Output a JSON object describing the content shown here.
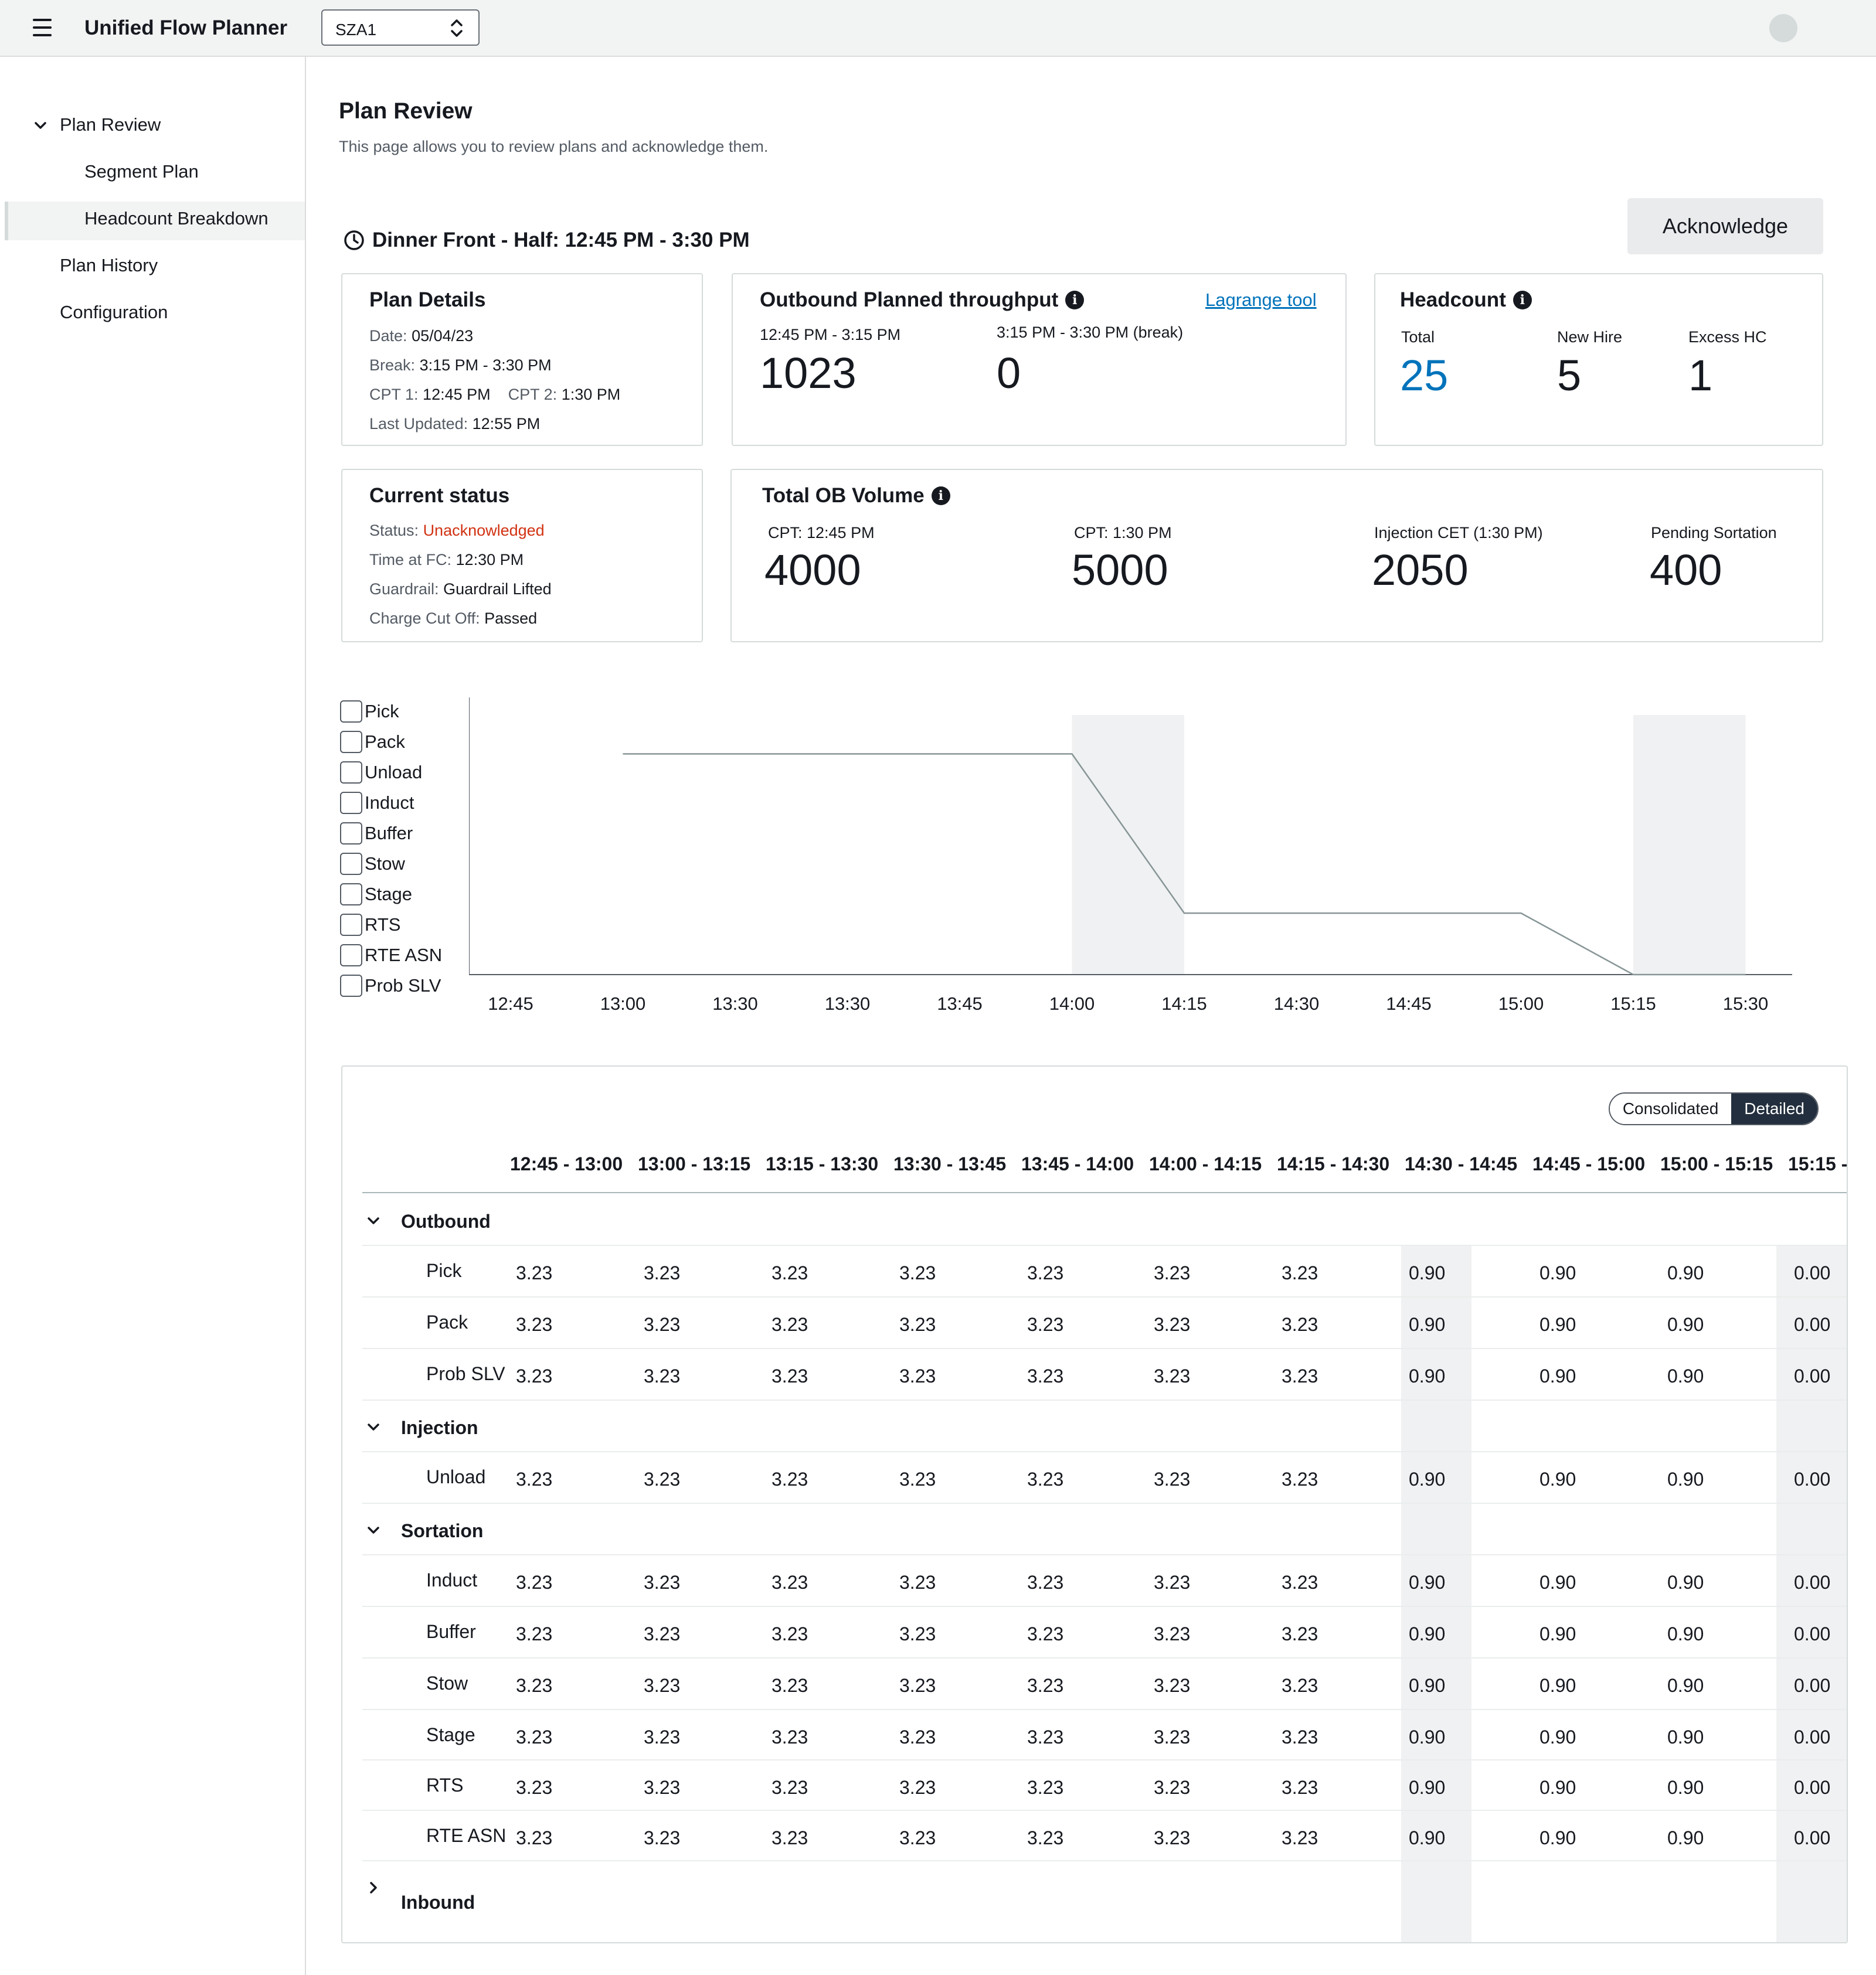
{
  "app": {
    "title": "Unified Flow Planner",
    "site": "SZA1"
  },
  "sidebar": {
    "items": [
      {
        "label": "Plan Review"
      },
      {
        "label": "Segment Plan"
      },
      {
        "label": "Headcount Breakdown"
      },
      {
        "label": "Plan History"
      },
      {
        "label": "Configuration"
      }
    ]
  },
  "page": {
    "title": "Plan Review",
    "description": "This page allows you to review plans and acknowledge them.",
    "shift_title": "Dinner Front - Half: 12:45 PM - 3:30 PM",
    "acknowledge_label": "Acknowledge"
  },
  "plan_details": {
    "title": "Plan Details",
    "date_label": "Date:",
    "date": "05/04/23",
    "break_label": "Break:",
    "break": "3:15 PM - 3:30 PM",
    "cpt1_label": "CPT 1:",
    "cpt1": "12:45 PM",
    "cpt2_label": "CPT 2:",
    "cpt2": "1:30 PM",
    "updated_label": "Last Updated:",
    "updated": "12:55 PM"
  },
  "throughput": {
    "title": "Outbound Planned throughput",
    "link": "Lagrange tool",
    "p1_label": "12:45 PM - 3:15 PM",
    "p1_value": "1023",
    "p2_label": "3:15 PM - 3:30 PM (break)",
    "p2_value": "0"
  },
  "headcount": {
    "title": "Headcount",
    "total_label": "Total",
    "total": "25",
    "newhire_label": "New Hire",
    "newhire": "5",
    "excess_label": "Excess HC",
    "excess": "1",
    "accent_color": "#0073bb"
  },
  "current_status": {
    "title": "Current status",
    "status_label": "Status:",
    "status": "Unacknowledged",
    "time_label": "Time at FC:",
    "time": "12:30 PM",
    "guardrail_label": "Guardrail:",
    "guardrail": "Guardrail Lifted",
    "charge_label": "Charge Cut Off:",
    "charge": "Passed",
    "status_color": "#d13212"
  },
  "ob_volume": {
    "title": "Total OB Volume",
    "items": [
      {
        "label": "CPT: 12:45 PM",
        "value": "4000"
      },
      {
        "label": "CPT: 1:30 PM",
        "value": "5000"
      },
      {
        "label": "Injection CET (1:30 PM)",
        "value": "2050"
      },
      {
        "label": "Pending Sortation",
        "value": "400"
      }
    ]
  },
  "chart_legend": [
    "Pick",
    "Pack",
    "Unload",
    "Induct",
    "Buffer",
    "Stow",
    "Stage",
    "RTS",
    "RTE ASN",
    "Prob SLV"
  ],
  "chart_data": {
    "type": "line",
    "categories": [
      "12:45",
      "13:00",
      "13:30",
      "13:30",
      "13:45",
      "14:00",
      "14:15",
      "14:30",
      "14:45",
      "15:00",
      "15:15",
      "15:30"
    ],
    "series": [
      {
        "values": [
          null,
          3.23,
          3.23,
          3.23,
          3.23,
          3.23,
          0.9,
          0.9,
          0.9,
          0.9,
          0.0,
          0.0
        ]
      }
    ],
    "shaded_categories": [
      "14:00",
      "15:15"
    ],
    "ylim": [
      0,
      3.8
    ],
    "grid": false
  },
  "table": {
    "toggle": {
      "consolidated": "Consolidated",
      "detailed": "Detailed"
    },
    "columns": [
      "12:45 - 13:00",
      "13:00 - 13:15",
      "13:15 - 13:30",
      "13:30 - 13:45",
      "13:45 - 14:00",
      "14:00 - 14:15",
      "14:15 - 14:30",
      "14:30 - 14:45",
      "14:45 - 15:00",
      "15:00 - 15:15",
      "15:15 -"
    ],
    "groups": [
      {
        "name": "Outbound",
        "rows": [
          {
            "label": "Pick",
            "values": [
              "3.23",
              "3.23",
              "3.23",
              "3.23",
              "3.23",
              "3.23",
              "3.23",
              "0.90",
              "0.90",
              "0.90",
              "0.00"
            ]
          },
          {
            "label": "Pack",
            "values": [
              "3.23",
              "3.23",
              "3.23",
              "3.23",
              "3.23",
              "3.23",
              "3.23",
              "0.90",
              "0.90",
              "0.90",
              "0.00"
            ]
          },
          {
            "label": "Prob SLV",
            "values": [
              "3.23",
              "3.23",
              "3.23",
              "3.23",
              "3.23",
              "3.23",
              "3.23",
              "0.90",
              "0.90",
              "0.90",
              "0.00"
            ]
          }
        ]
      },
      {
        "name": "Injection",
        "rows": [
          {
            "label": "Unload",
            "values": [
              "3.23",
              "3.23",
              "3.23",
              "3.23",
              "3.23",
              "3.23",
              "3.23",
              "0.90",
              "0.90",
              "0.90",
              "0.00"
            ]
          }
        ]
      },
      {
        "name": "Sortation",
        "rows": [
          {
            "label": "Induct",
            "values": [
              "3.23",
              "3.23",
              "3.23",
              "3.23",
              "3.23",
              "3.23",
              "3.23",
              "0.90",
              "0.90",
              "0.90",
              "0.00"
            ]
          },
          {
            "label": "Buffer",
            "values": [
              "3.23",
              "3.23",
              "3.23",
              "3.23",
              "3.23",
              "3.23",
              "3.23",
              "0.90",
              "0.90",
              "0.90",
              "0.00"
            ]
          },
          {
            "label": "Stow",
            "values": [
              "3.23",
              "3.23",
              "3.23",
              "3.23",
              "3.23",
              "3.23",
              "3.23",
              "0.90",
              "0.90",
              "0.90",
              "0.00"
            ]
          },
          {
            "label": "Stage",
            "values": [
              "3.23",
              "3.23",
              "3.23",
              "3.23",
              "3.23",
              "3.23",
              "3.23",
              "0.90",
              "0.90",
              "0.90",
              "0.00"
            ]
          },
          {
            "label": "RTS",
            "values": [
              "3.23",
              "3.23",
              "3.23",
              "3.23",
              "3.23",
              "3.23",
              "3.23",
              "0.90",
              "0.90",
              "0.90",
              "0.00"
            ]
          },
          {
            "label": "RTE ASN",
            "values": [
              "3.23",
              "3.23",
              "3.23",
              "3.23",
              "3.23",
              "3.23",
              "3.23",
              "0.90",
              "0.90",
              "0.90",
              "0.00"
            ]
          }
        ]
      },
      {
        "name": "Inbound",
        "rows": []
      }
    ]
  }
}
